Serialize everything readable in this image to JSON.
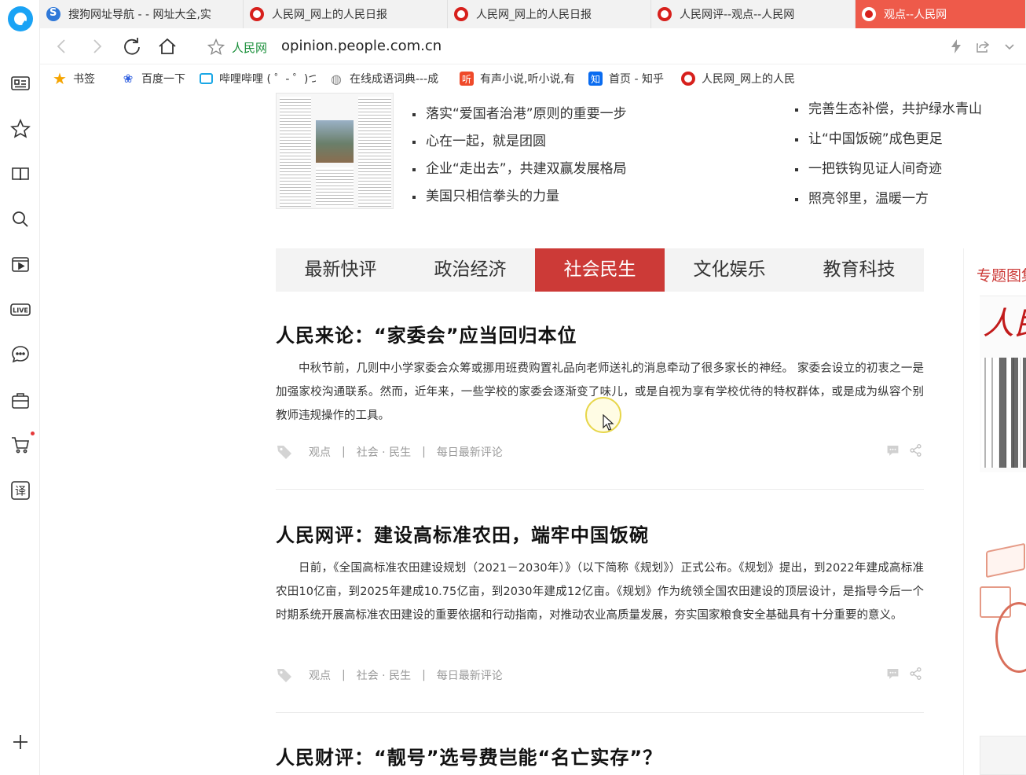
{
  "browser": {
    "tabs": [
      {
        "label": "搜狗网址导航 - - 网址大全,实",
        "favicon": "sogou-icon",
        "active": false
      },
      {
        "label": "人民网_网上的人民日报",
        "favicon": "people-icon",
        "active": false
      },
      {
        "label": "人民网_网上的人民日报",
        "favicon": "people-icon",
        "active": false
      },
      {
        "label": "人民网评--观点--人民网",
        "favicon": "people-icon",
        "active": false
      },
      {
        "label": "观点--人民网",
        "favicon": "people-icon",
        "active": true
      }
    ],
    "address": {
      "site_tag": "人民网",
      "url": "opinion.people.com.cn"
    },
    "bookmarks": [
      {
        "label": "书签",
        "icon": "star-icon"
      },
      {
        "label": "百度一下",
        "icon": "baidu-icon"
      },
      {
        "label": "哔哩哔哩 ( ゜- ゜)つ",
        "icon": "bilibili-icon"
      },
      {
        "label": "在线成语词典---成",
        "icon": "globe-icon"
      },
      {
        "label": "有声小说,听小说,有",
        "icon": "tingshu-icon"
      },
      {
        "label": "首页 - 知乎",
        "icon": "zhihu-icon"
      },
      {
        "label": "人民网_网上的人民",
        "icon": "people-icon"
      }
    ],
    "accent_color": "#ee5a4a"
  },
  "headlines": {
    "left": [
      "落实“爱国者治港”原则的重要一步",
      "心在一起，就是团圆",
      "企业“走出去”，共建双赢发展格局",
      "美国只相信拳头的力量"
    ],
    "right": [
      "完善生态补偿，共护绿水青山",
      "让“中国饭碗”成色更足",
      "一把铁钩见证人间奇迹",
      "照亮邻里，温暖一方"
    ]
  },
  "category_tabs": [
    {
      "label": "最新快评",
      "active": false
    },
    {
      "label": "政治经济",
      "active": false
    },
    {
      "label": "社会民生",
      "active": true
    },
    {
      "label": "文化娱乐",
      "active": false
    },
    {
      "label": "教育科技",
      "active": false
    }
  ],
  "articles": [
    {
      "title": "人民来论：“家委会”应当回归本位",
      "summary": "中秋节前，几则中小学家委会众筹或挪用班费购置礼品向老师送礼的消息牵动了很多家长的神经。 家委会设立的初衷之一是加强家校沟通联系。然而，近年来，一些学校的家委会逐渐变了味儿，或是自视为享有学校优待的特权群体，或是成为纵容个别教师违规操作的工具。",
      "tags": [
        "观点",
        "社会 · 民生",
        "每日最新评论"
      ]
    },
    {
      "title": "人民网评：建设高标准农田，端牢中国饭碗",
      "summary": "日前，《全国高标准农田建设规划（2021－2030年）》（以下简称《规划》）正式公布。《规划》提出，到2022年建成高标准农田10亿亩，到2025年建成10.75亿亩，到2030年建成12亿亩。《规划》作为统领全国农田建设的顶层设计，是指导今后一个时期系统开展高标准农田建设的重要依据和行动指南，对推动农业高质量发展，夯实国家粮食安全基础具有十分重要的意义。",
      "tags": [
        "观点",
        "社会 · 民生",
        "每日最新评论"
      ]
    },
    {
      "title": "人民财评：“靓号”选号费岂能“名亡实存”？"
    }
  ],
  "sidebar_special": {
    "title": "专题图集"
  },
  "theme": {
    "category_active": "#cc3a37",
    "site_green": "#1a8f3a"
  }
}
